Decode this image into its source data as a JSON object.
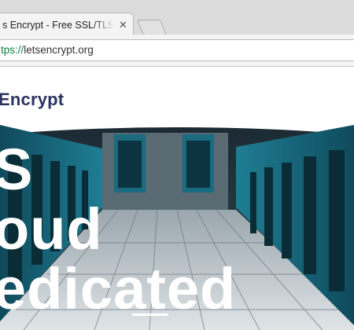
{
  "browser": {
    "tab_title": "s Encrypt - Free SSL/TLS C",
    "tab_close": "✕",
    "url_scheme": "tps://",
    "url_host": "letsencrypt.org"
  },
  "site": {
    "logo_text": "Encrypt",
    "hero_lines": [
      "S",
      "oud",
      "edicated"
    ]
  }
}
